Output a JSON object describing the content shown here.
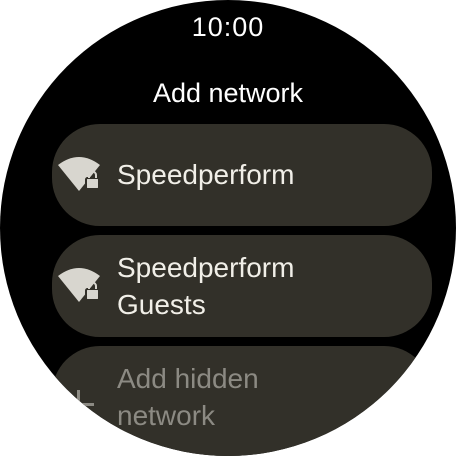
{
  "status_bar": {
    "time": "10:00"
  },
  "screen": {
    "title": "Add network"
  },
  "networks": [
    {
      "name": "Speedperform",
      "icon": "wifi-lock-icon"
    },
    {
      "name_line1": "Speedperform",
      "name_line2": "Guests",
      "icon": "wifi-lock-icon"
    }
  ],
  "add_hidden": {
    "line1": "Add hidden",
    "line2": "network",
    "icon": "plus-icon"
  },
  "colors": {
    "background": "#000000",
    "chip": "#323029",
    "text": "#f1efe8",
    "muted_text": "#8c8a83"
  }
}
